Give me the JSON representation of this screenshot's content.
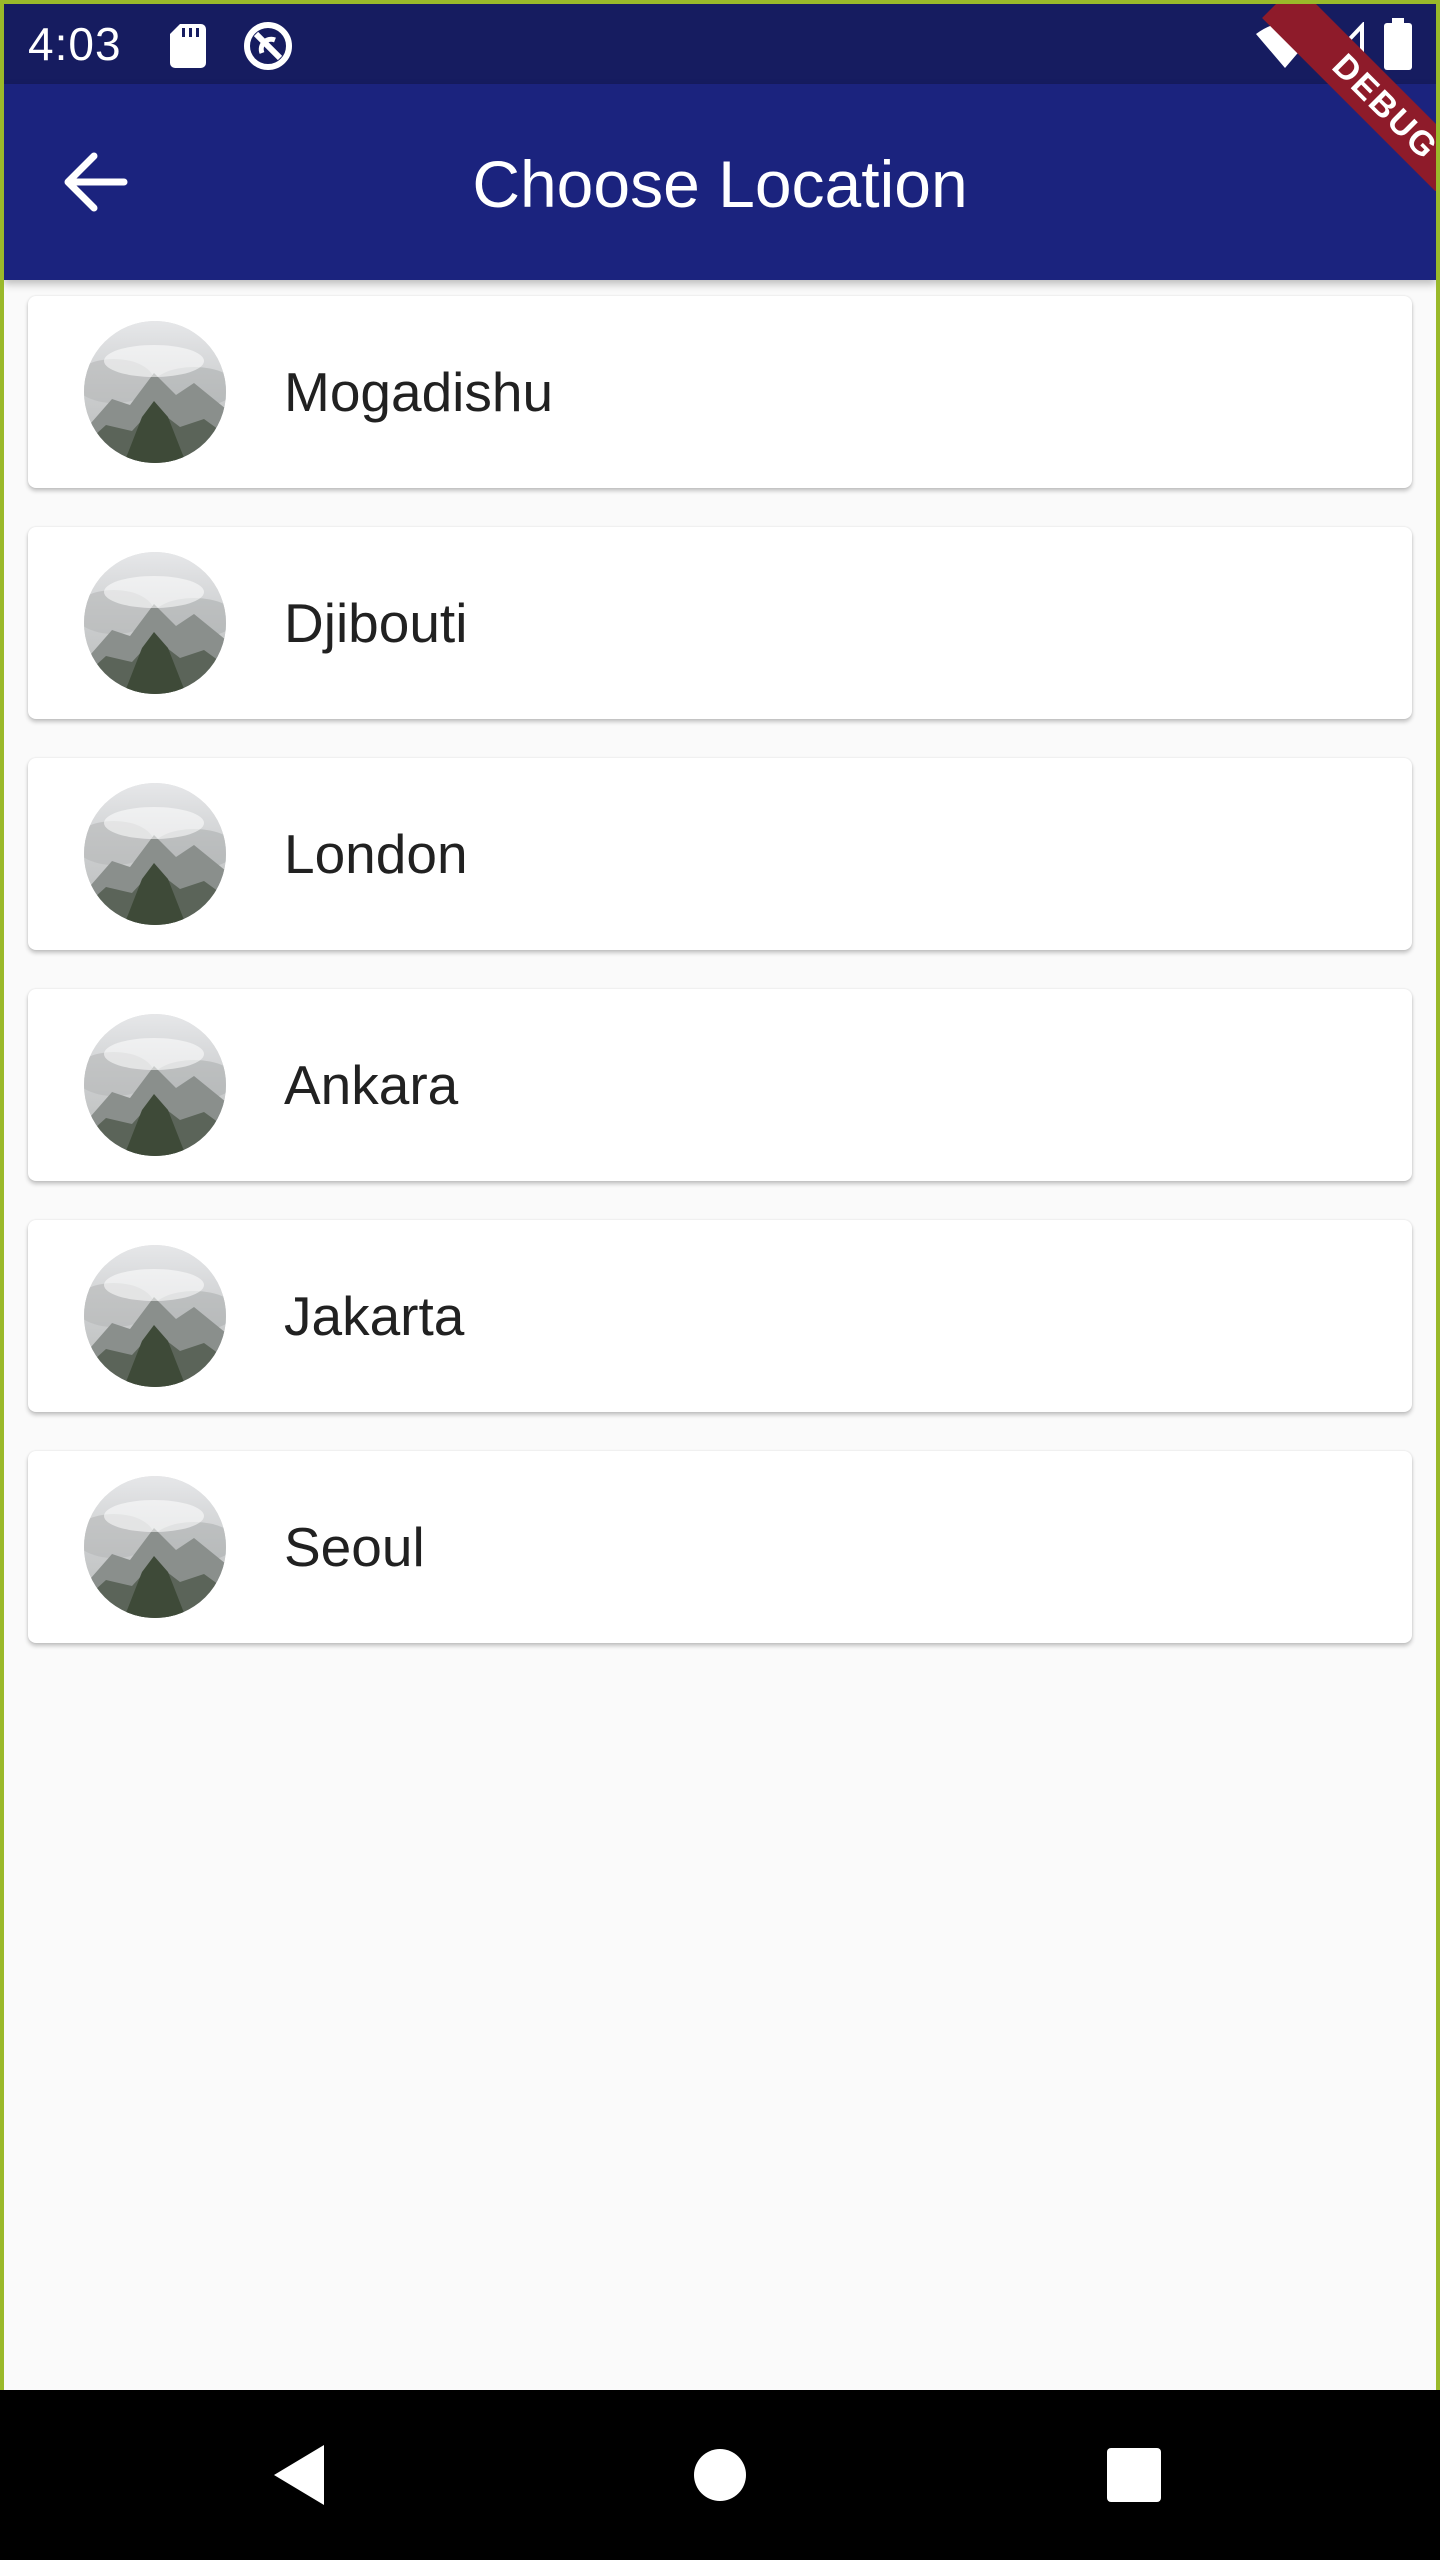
{
  "status_bar": {
    "time": "4:03",
    "icons": [
      "sd-card-icon",
      "sync-icon",
      "wifi-icon",
      "cell-signal-icon",
      "battery-icon"
    ]
  },
  "debug_banner": {
    "label": "DEBUG"
  },
  "app_bar": {
    "title": "Choose Location",
    "back_icon": "arrow-back-icon"
  },
  "locations": [
    {
      "name": "Mogadishu",
      "icon": "location-thumbnail"
    },
    {
      "name": "Djibouti",
      "icon": "location-thumbnail"
    },
    {
      "name": "London",
      "icon": "location-thumbnail"
    },
    {
      "name": "Ankara",
      "icon": "location-thumbnail"
    },
    {
      "name": "Jakarta",
      "icon": "location-thumbnail"
    },
    {
      "name": "Seoul",
      "icon": "location-thumbnail"
    }
  ],
  "nav_bar": {
    "icons": [
      "back-triangle-icon",
      "home-circle-icon",
      "recents-square-icon"
    ]
  },
  "colors": {
    "status_bar": "#161c60",
    "app_bar": "#1b237e",
    "background": "#fafafa",
    "debug_ribbon": "#8e1b2a",
    "frame_border": "#9ab92a"
  }
}
